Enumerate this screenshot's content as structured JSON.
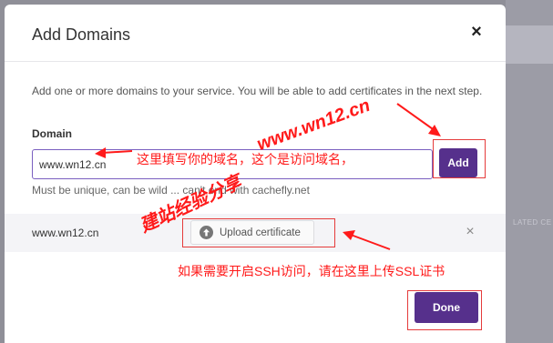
{
  "dialog": {
    "title": "Add Domains",
    "description": "Add one or more domains to your service. You will be able to add certificates in the next step.",
    "domain_label": "Domain",
    "domain_input_value": "www.wn12.cn",
    "add_button": "Add",
    "hint": "Must be unique, can be wild ... can't end with cachefly.net",
    "domain_row": {
      "domain": "www.wn12.cn",
      "upload_button": "Upload certificate"
    },
    "done_button": "Done"
  },
  "background": {
    "partial_text": "LATED CE"
  },
  "annotations": {
    "input_note": "这里填写你的域名，这个是访问域名，",
    "url_watermark": "www.wn12.cn",
    "site_watermark": "建站经验分享",
    "upload_note": "如果需要开启SSH访问，请在这里上传SSL证书"
  },
  "icons": {
    "close": "close-icon",
    "upload": "upload-arrow-icon",
    "remove": "remove-icon"
  },
  "colors": {
    "primary": "#56308c",
    "annotation": "#ff1a1a",
    "overlay": "#8f8f98"
  }
}
